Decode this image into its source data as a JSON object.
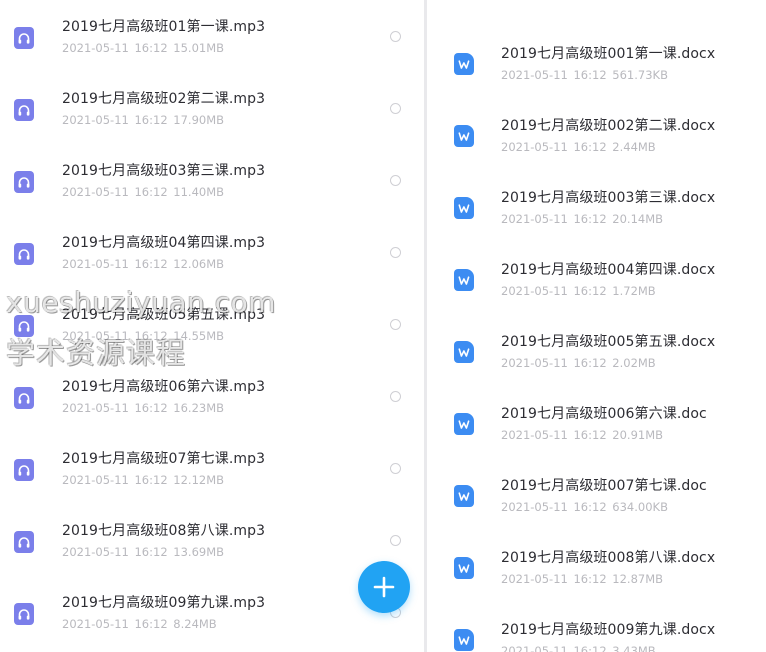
{
  "left_panel": {
    "files": [
      {
        "name": "2019七月高级班01第一课.mp3",
        "meta": "2021-05-11 16:12 15.01MB"
      },
      {
        "name": "2019七月高级班02第二课.mp3",
        "meta": "2021-05-11 16:12 17.90MB"
      },
      {
        "name": "2019七月高级班03第三课.mp3",
        "meta": "2021-05-11 16:12 11.40MB"
      },
      {
        "name": "2019七月高级班04第四课.mp3",
        "meta": "2021-05-11 16:12 12.06MB"
      },
      {
        "name": "2019七月高级班05第五课.mp3",
        "meta": "2021-05-11 16:12 14.55MB"
      },
      {
        "name": "2019七月高级班06第六课.mp3",
        "meta": "2021-05-11 16:12 16.23MB"
      },
      {
        "name": "2019七月高级班07第七课.mp3",
        "meta": "2021-05-11 16:12 12.12MB"
      },
      {
        "name": "2019七月高级班08第八课.mp3",
        "meta": "2021-05-11 16:12 13.69MB"
      },
      {
        "name": "2019七月高级班09第九课.mp3",
        "meta": "2021-05-11 16:12 8.24MB"
      }
    ]
  },
  "right_panel": {
    "files": [
      {
        "name": "2019七月高级班001第一课.docx",
        "meta": "2021-05-11 16:12 561.73KB"
      },
      {
        "name": "2019七月高级班002第二课.docx",
        "meta": "2021-05-11 16:12 2.44MB"
      },
      {
        "name": "2019七月高级班003第三课.docx",
        "meta": "2021-05-11 16:12 20.14MB"
      },
      {
        "name": "2019七月高级班004第四课.docx",
        "meta": "2021-05-11 16:12 1.72MB"
      },
      {
        "name": "2019七月高级班005第五课.docx",
        "meta": "2021-05-11 16:12 2.02MB"
      },
      {
        "name": "2019七月高级班006第六课.doc",
        "meta": "2021-05-11 16:12 20.91MB"
      },
      {
        "name": "2019七月高级班007第七课.doc",
        "meta": "2021-05-11 16:12 634.00KB"
      },
      {
        "name": "2019七月高级班008第八课.docx",
        "meta": "2021-05-11 16:12 12.87MB"
      },
      {
        "name": "2019七月高级班009第九课.docx",
        "meta": "2021-05-11 16:12 3.43MB"
      }
    ]
  },
  "fab": {
    "icon": "plus-icon",
    "color": "#21a3f3"
  },
  "icons": {
    "audio": "headphones-icon",
    "document": "word-doc-icon"
  },
  "colors": {
    "audio_icon": "#7b7fea",
    "doc_icon": "#3c8cf2"
  },
  "watermark": {
    "line1": "xueshuziyuan.com",
    "line2": "学术资源课程"
  }
}
